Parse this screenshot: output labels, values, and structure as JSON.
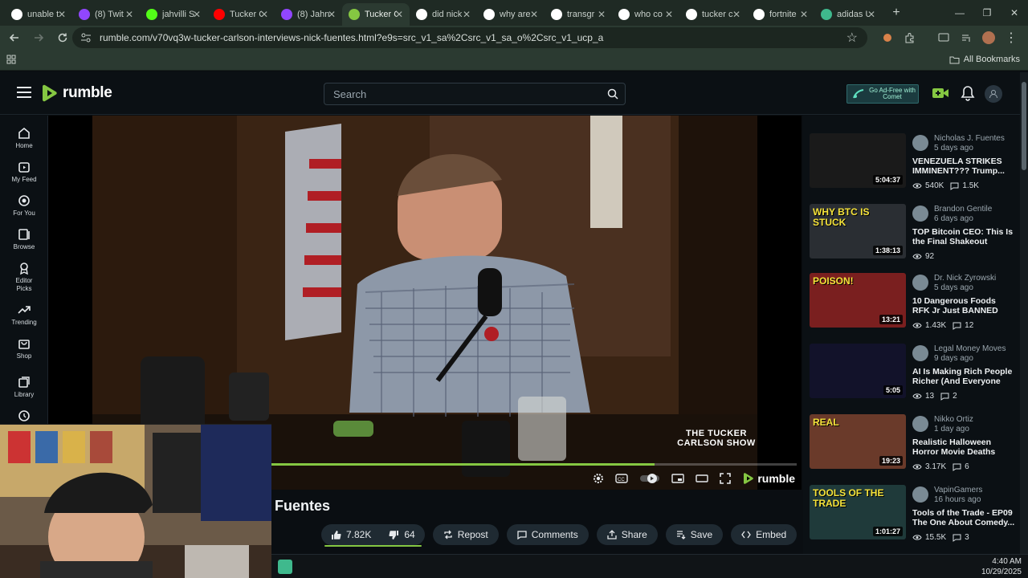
{
  "browser": {
    "tabs": [
      {
        "label": "unable t",
        "color": "#ffffff",
        "icon": "google-icon"
      },
      {
        "label": "(8) Twit",
        "color": "#9146ff",
        "icon": "twitch-icon"
      },
      {
        "label": "jahvilli S",
        "color": "#53fc18",
        "icon": "kick-icon"
      },
      {
        "label": "Tucker C",
        "color": "#ff0000",
        "icon": "youtube-icon"
      },
      {
        "label": "(8) Jahn",
        "color": "#9146ff",
        "icon": "twitch-icon"
      },
      {
        "label": "Tucker C",
        "color": "#85c742",
        "icon": "rumble-icon",
        "active": true
      },
      {
        "label": "did nick",
        "color": "#ffffff",
        "icon": "google-icon"
      },
      {
        "label": "why are",
        "color": "#ffffff",
        "icon": "google-icon"
      },
      {
        "label": "transgr",
        "color": "#ffffff",
        "icon": "google-icon"
      },
      {
        "label": "who co",
        "color": "#ffffff",
        "icon": "google-icon"
      },
      {
        "label": "tucker c",
        "color": "#ffffff",
        "icon": "google-icon"
      },
      {
        "label": "fortnite",
        "color": "#ffffff",
        "icon": "google-icon"
      },
      {
        "label": "adidas U",
        "color": "#3fb98d",
        "icon": "adidas-icon"
      }
    ],
    "url": "rumble.com/v70vq3w-tucker-carlson-interviews-nick-fuentes.html?e9s=src_v1_sa%2Csrc_v1_sa_o%2Csrc_v1_ucp_a",
    "all_bookmarks": "All Bookmarks"
  },
  "site": {
    "logo": "rumble",
    "search_placeholder": "Search",
    "adfree": "Go Ad-Free with Comet"
  },
  "nav": [
    {
      "label": "Home",
      "icon": "home-icon"
    },
    {
      "label": "My Feed",
      "icon": "feed-icon"
    },
    {
      "label": "For You",
      "icon": "for-you-icon"
    },
    {
      "label": "Browse",
      "icon": "browse-icon"
    },
    {
      "label": "Editor Picks",
      "icon": "editor-picks-icon"
    },
    {
      "label": "Trending",
      "icon": "trending-icon"
    },
    {
      "label": "Shop",
      "icon": "shop-icon"
    },
    {
      "label": "Library",
      "icon": "library-icon"
    }
  ],
  "player": {
    "progress": 0.73,
    "logo": "rumble",
    "watermark": "THE TUCKER CARLSON SHOW"
  },
  "video": {
    "title": "Fuentes",
    "likes": "7.82K",
    "dislikes": "64",
    "actions": [
      "Repost",
      "Comments",
      "Share",
      "Save",
      "Embed"
    ]
  },
  "recommendations": [
    {
      "channel": "Nicholas J. Fuentes",
      "age": "5 days ago",
      "title": "VENEZUELA STRIKES IMMINENT??? Trump...",
      "duration": "5:04:37",
      "views": "540K",
      "comments": "1.5K",
      "thumb_color": "#1a1a1a",
      "thumb_text": ""
    },
    {
      "channel": "Brandon Gentile",
      "age": "6 days ago",
      "title": "TOP Bitcoin CEO: This Is the Final Shakeout Befor...",
      "duration": "1:38:13",
      "views": "92",
      "comments": "",
      "thumb_color": "#2a2e33",
      "thumb_text": "WHY BTC IS STUCK"
    },
    {
      "channel": "Dr. Nick Zyrowski",
      "age": "5 days ago",
      "title": "10 Dangerous Foods RFK Jr Just BANNED",
      "duration": "13:21",
      "views": "1.43K",
      "comments": "12",
      "thumb_color": "#7a1f1f",
      "thumb_text": "POISON!"
    },
    {
      "channel": "Legal Money Moves",
      "age": "9 days ago",
      "title": "AI Is Making Rich People Richer (And Everyone El...",
      "duration": "5:05",
      "views": "13",
      "comments": "2",
      "thumb_color": "#12122a",
      "thumb_text": ""
    },
    {
      "channel": "Nikko Ortiz",
      "age": "1 day ago",
      "title": "Realistic Halloween Horror Movie Deaths",
      "duration": "19:23",
      "views": "3.17K",
      "comments": "6",
      "thumb_color": "#6a3a2a",
      "thumb_text": "REAL"
    },
    {
      "channel": "VapinGamers",
      "age": "16 hours ago",
      "title": "Tools of the Trade - EP09 The One About Comedy...",
      "duration": "1:01:27",
      "views": "15.5K",
      "comments": "3",
      "thumb_color": "#1f3a3a",
      "thumb_text": "TOOLS OF THE TRADE"
    }
  ],
  "clock": {
    "time": "4:40 AM",
    "date": "10/29/2025"
  },
  "colors": {
    "accent": "#85c742",
    "bg": "#0b1014"
  }
}
